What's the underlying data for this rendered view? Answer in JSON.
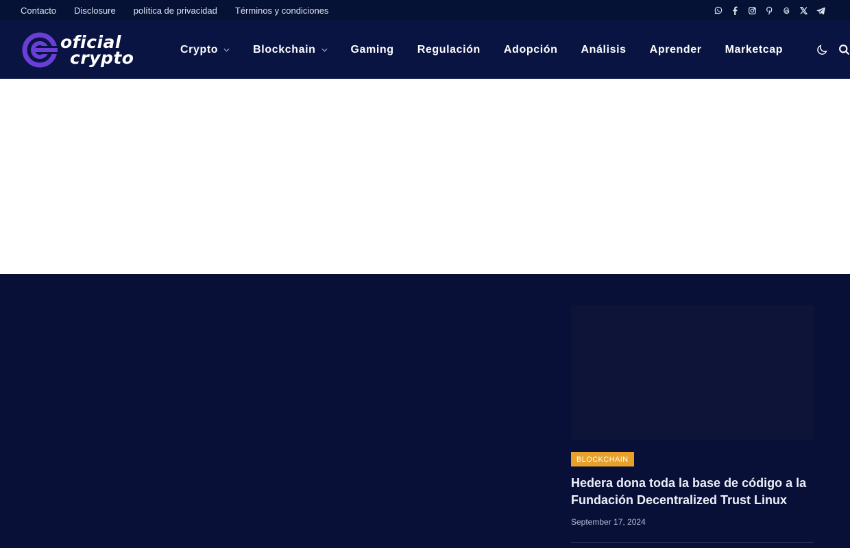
{
  "topbar": {
    "links": [
      "Contacto",
      "Disclosure",
      "política de privacidad",
      "Términos y condiciones"
    ],
    "socials": [
      "whatsapp-icon",
      "facebook-icon",
      "instagram-icon",
      "pinterest-icon",
      "threads-icon",
      "x-icon",
      "telegram-icon"
    ]
  },
  "logo": {
    "line1": "oficial",
    "line2": "crypto",
    "accent_color": "#6a3fd8"
  },
  "nav": {
    "items": [
      {
        "label": "Crypto",
        "has_dropdown": true
      },
      {
        "label": "Blockchain",
        "has_dropdown": true
      },
      {
        "label": "Gaming",
        "has_dropdown": false
      },
      {
        "label": "Regulación",
        "has_dropdown": false
      },
      {
        "label": "Adopción",
        "has_dropdown": false
      },
      {
        "label": "Análisis",
        "has_dropdown": false
      },
      {
        "label": "Aprender",
        "has_dropdown": false
      },
      {
        "label": "Marketcap",
        "has_dropdown": false
      }
    ],
    "icons": [
      "moon-icon",
      "search-icon"
    ]
  },
  "featured_card": {
    "category": "Blockchain",
    "title": "Hedera dona toda la base de código a la Fundación Decentralized Trust Linux",
    "date": "September 17, 2024"
  },
  "colors": {
    "topbar_bg": "#061235",
    "nav_bg": "#0a1442",
    "content_bg": "#081038",
    "category_badge": "#e8a02b"
  }
}
